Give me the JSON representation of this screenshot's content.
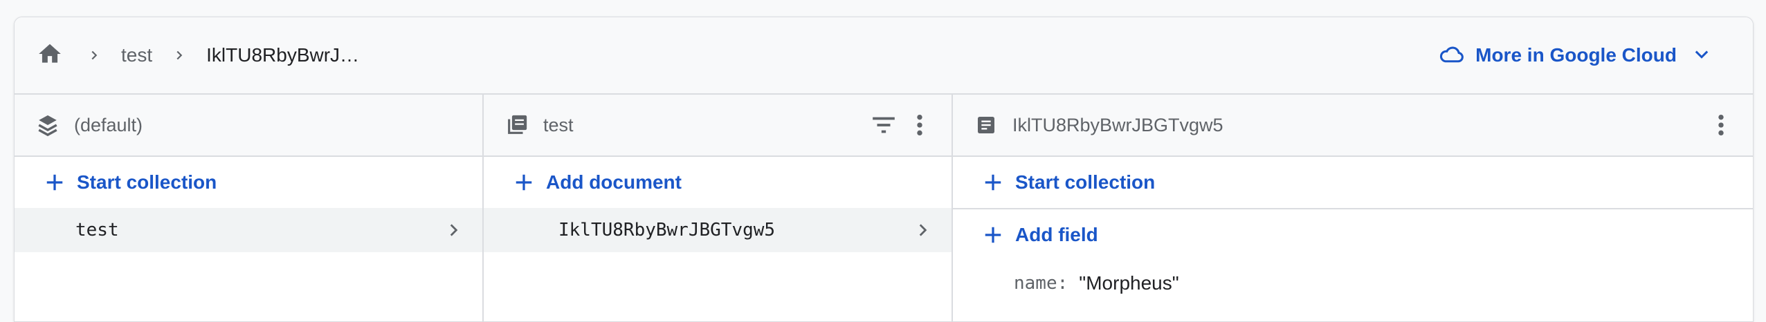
{
  "breadcrumb": {
    "items": [
      "test",
      "IklTU8RbyBwrJ…"
    ]
  },
  "header": {
    "google_cloud_label": "More in Google Cloud"
  },
  "panels": {
    "database": {
      "title": "(default)",
      "action_label": "Start collection",
      "items": [
        "test"
      ]
    },
    "collection": {
      "title": "test",
      "action_label": "Add document",
      "items": [
        "IklTU8RbyBwrJBGTvgw5"
      ]
    },
    "document": {
      "title": "IklTU8RbyBwrJBGTvgw5",
      "start_collection_label": "Start collection",
      "add_field_label": "Add field",
      "fields": [
        {
          "key": "name",
          "value": "\"Morpheus\""
        }
      ]
    }
  },
  "colors": {
    "accent": "#1a56c8",
    "icon": "#5f6368",
    "header_bg": "#f8f9fa",
    "selected_row_bg": "#f1f3f4"
  },
  "icons": {
    "home": "home-icon",
    "chevron": "chevron-right-icon",
    "cloud": "cloud-icon",
    "expand": "chevron-down-icon",
    "database": "stack-icon",
    "collection": "collection-icon",
    "document": "document-icon",
    "filter": "filter-icon",
    "more": "more-vert-icon",
    "add": "plus-icon"
  }
}
